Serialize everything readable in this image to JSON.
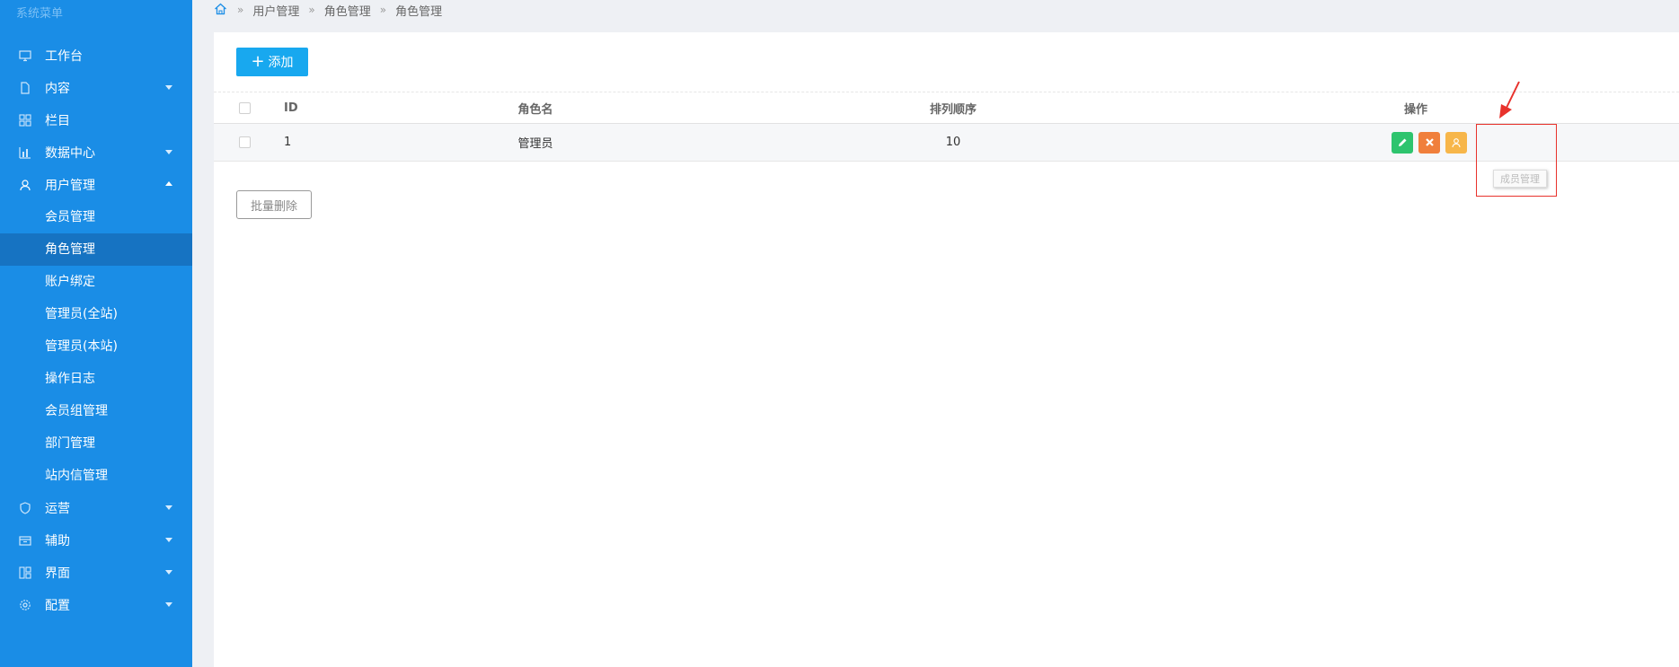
{
  "sidebar": {
    "title": "系统菜单",
    "items": [
      {
        "label": "工作台",
        "icon": "monitor-icon",
        "has_caret": false
      },
      {
        "label": "内容",
        "icon": "file-icon",
        "has_caret": true
      },
      {
        "label": "栏目",
        "icon": "grid-icon",
        "has_caret": false
      },
      {
        "label": "数据中心",
        "icon": "bar-chart-icon",
        "has_caret": true
      },
      {
        "label": "用户管理",
        "icon": "user-icon",
        "has_caret": true,
        "expanded": true
      }
    ],
    "sub_items": [
      {
        "label": "会员管理",
        "active": false
      },
      {
        "label": "角色管理",
        "active": true
      },
      {
        "label": "账户绑定",
        "active": false
      },
      {
        "label": "管理员(全站)",
        "active": false
      },
      {
        "label": "管理员(本站)",
        "active": false
      },
      {
        "label": "操作日志",
        "active": false
      },
      {
        "label": "会员组管理",
        "active": false
      },
      {
        "label": "部门管理",
        "active": false
      },
      {
        "label": "站内信管理",
        "active": false
      }
    ],
    "bottom_items": [
      {
        "label": "运营",
        "icon": "shield-icon"
      },
      {
        "label": "辅助",
        "icon": "box-icon"
      },
      {
        "label": "界面",
        "icon": "layout-icon"
      },
      {
        "label": "配置",
        "icon": "gear-icon"
      }
    ]
  },
  "breadcrumb": [
    "用户管理",
    "角色管理",
    "角色管理"
  ],
  "toolbar": {
    "add_label": "添加"
  },
  "table": {
    "headers": {
      "id": "ID",
      "name": "角色名",
      "order": "排列顺序",
      "actions": "操作"
    },
    "rows": [
      {
        "id": "1",
        "name": "管理员",
        "order": "10"
      }
    ]
  },
  "batch_delete_label": "批量删除",
  "tooltip": "成员管理",
  "colors": {
    "sidebar_bg": "#1a8de6",
    "active_item_bg": "#1673c2",
    "add_button": "#18a8ef",
    "edit_button": "#2ec46e",
    "delete_button": "#f07f3c",
    "member_button": "#f7b64a",
    "annotation_red": "#e8322c"
  }
}
